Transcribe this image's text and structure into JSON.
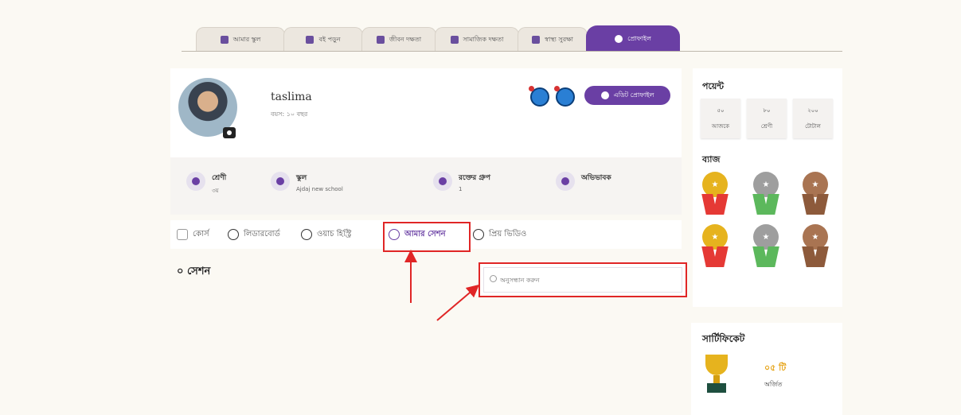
{
  "top_tabs": [
    {
      "label": "আমার স্কুল",
      "icon": "school-icon"
    },
    {
      "label": "বই পড়ুন",
      "icon": "book-icon"
    },
    {
      "label": "জীবন দক্ষতা",
      "icon": "life-skills-icon"
    },
    {
      "label": "সামাজিক দক্ষতা",
      "icon": "social-skills-icon"
    },
    {
      "label": "স্বাস্থ্য সুরক্ষা",
      "icon": "health-icon"
    },
    {
      "label": "প্রোফাইল",
      "icon": "profile-icon"
    }
  ],
  "active_tab": "প্রোফাইল",
  "profile": {
    "name": "taslima",
    "age": "বয়স: ১০ বছর",
    "edit_button": "এডিট প্রোফাইল",
    "info": [
      {
        "label": "শ্রেণী",
        "value": "৩য়"
      },
      {
        "label": "স্কুল",
        "value": "Ajdaj new school"
      },
      {
        "label": "রক্তের গ্রুপ",
        "value": "1"
      },
      {
        "label": "অভিভাবক",
        "value": ""
      }
    ]
  },
  "sub_tabs": [
    {
      "label": "কোর্স",
      "icon": "course-icon"
    },
    {
      "label": "লিডারবোর্ড",
      "icon": "leaderboard-icon"
    },
    {
      "label": "ওয়াচ হিস্ট্রি",
      "icon": "history-icon"
    },
    {
      "label": "আমার সেশন",
      "icon": "timer-icon",
      "active": true
    },
    {
      "label": "প্রিয় ভিডিও",
      "icon": "play-icon"
    }
  ],
  "session_count": "০ সেশন",
  "search": {
    "placeholder": "অনুসন্ধান করুন"
  },
  "points": {
    "title": "পয়েন্ট",
    "boxes": [
      {
        "value": "৫০",
        "label": "আজকে"
      },
      {
        "value": "৮০",
        "label": "শ্রেণী"
      },
      {
        "value": "২০০",
        "label": "টোটাল"
      }
    ],
    "badges_title": "ব্যাজ",
    "medals": [
      "gold",
      "silver",
      "bronze",
      "gold",
      "silver",
      "bronze"
    ]
  },
  "certificate": {
    "title": "সার্টিফিকেট",
    "count": "০৫ টি",
    "label": "অর্জিত"
  },
  "colors": {
    "accent": "#6a3fa4",
    "highlight": "#e02626",
    "gold": "#e6b31e",
    "silver": "#9e9e9e",
    "bronze": "#a97452"
  }
}
